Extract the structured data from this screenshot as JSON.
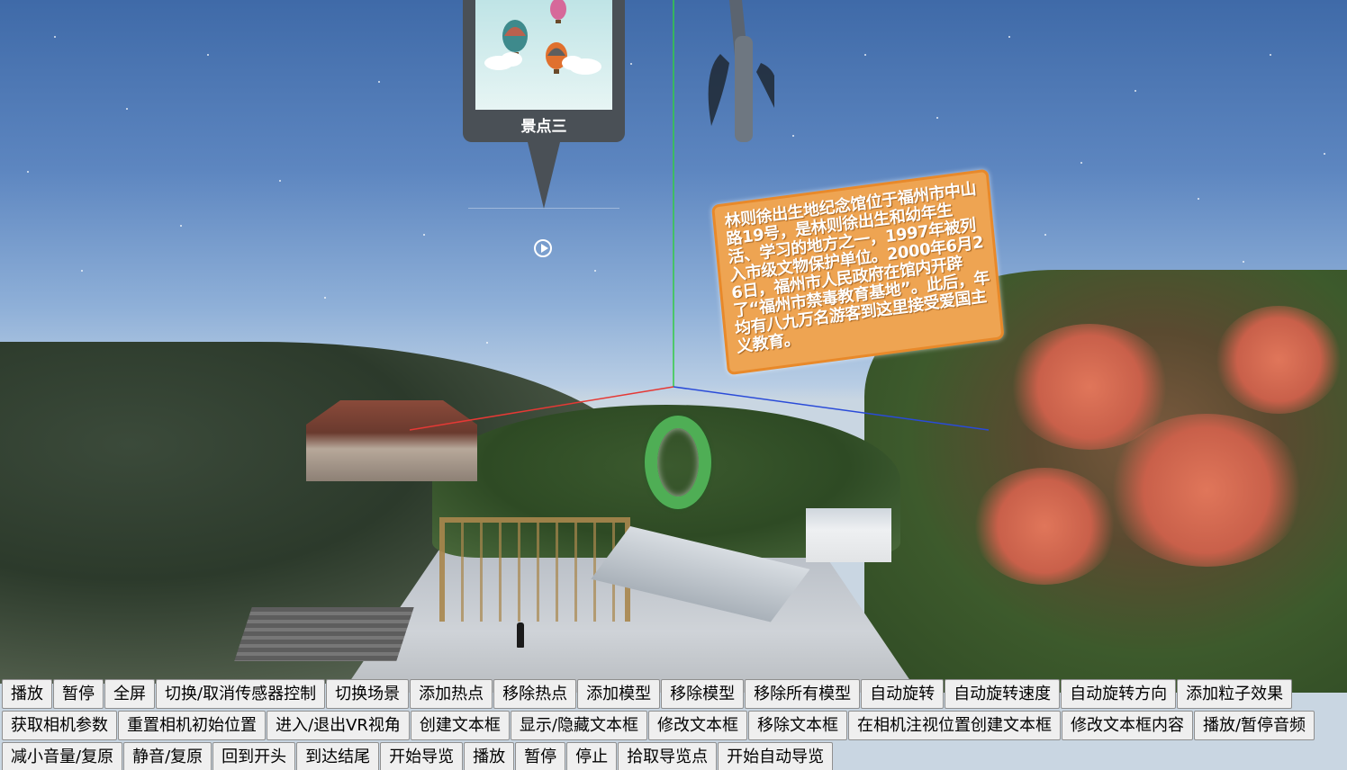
{
  "hotspot": {
    "title": "景点三"
  },
  "textbox": {
    "content": "林则徐出生地纪念馆位于福州市中山路19号，是林则徐出生和幼年生活、学习的地方之一，1997年被列入市级文物保护单位。2000年6月26日，福州市人民政府在馆内开辟了“福州市禁毒教育基地”。此后，年均有八九万名游客到这里接受爱国主义教育。"
  },
  "colors": {
    "x_axis": "#e53935",
    "y_axis": "#33cc44",
    "z_axis": "#2a4bd8",
    "textbox_bg": "#eea452",
    "ring": "#4fae55"
  },
  "toolbar": {
    "buttons": [
      "播放",
      "暂停",
      "全屏",
      "切换/取消传感器控制",
      "切换场景",
      "添加热点",
      "移除热点",
      "添加模型",
      "移除模型",
      "移除所有模型",
      "自动旋转",
      "自动旋转速度",
      "自动旋转方向",
      "添加粒子效果",
      "获取相机参数",
      "重置相机初始位置",
      "进入/退出VR视角",
      "创建文本框",
      "显示/隐藏文本框",
      "修改文本框",
      "移除文本框",
      "在相机注视位置创建文本框",
      "修改文本框内容",
      "播放/暂停音频",
      "减小音量/复原",
      "静音/复原",
      "回到开头",
      "到达结尾",
      "开始导览",
      "播放",
      "暂停",
      "停止",
      "拾取导览点",
      "开始自动导览"
    ]
  }
}
